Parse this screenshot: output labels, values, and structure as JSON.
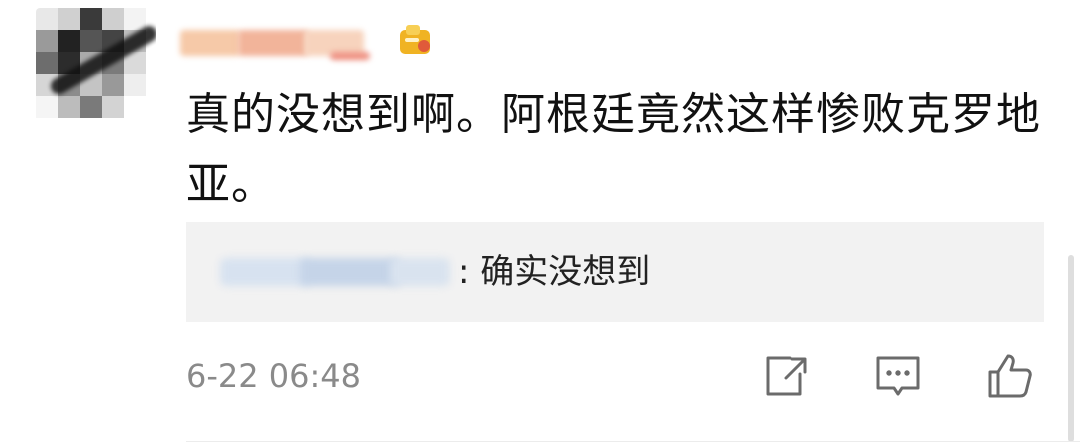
{
  "comment": {
    "text": "真的没想到啊。阿根廷竟然这样惨败克罗地亚。",
    "timestamp": "6-22 06:48"
  },
  "reply": {
    "text": ": 确实没想到"
  },
  "icons": {
    "share": "share-icon",
    "comment": "comment-icon",
    "like": "thumbs-up-icon",
    "badge": "level-badge-icon"
  },
  "colors": {
    "reply_background": "#f2f2f2",
    "timestamp": "#8a8a8a",
    "text": "#111111",
    "icon": "#6b6b6b",
    "badge": "#f0b323"
  }
}
